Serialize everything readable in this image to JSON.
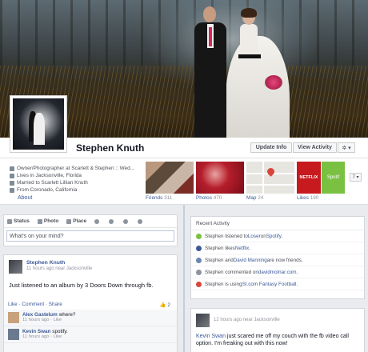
{
  "profile": {
    "name": "Stephen Knuth",
    "update_info": "Update Info",
    "view_activity": "View Activity",
    "gear": "✲ ▾"
  },
  "about": {
    "work": "Owner/Photographer at Scarlett & Stephen :: Wed...",
    "lives": "Lives in Jacksonville, Florida",
    "married": "Married to Scarlett Lillian Knuth",
    "from": "From Coronado, California",
    "link": "About"
  },
  "thumbs": {
    "friends_label": "Friends",
    "friends_count": "311",
    "photos_label": "Photos",
    "photos_count": "470",
    "map_label": "Map",
    "map_count": "24",
    "likes_label": "Likes",
    "likes_count": "190",
    "netflix": "NETFLIX",
    "spotify": "Spotif",
    "more": "7 ▾"
  },
  "composer": {
    "status": "Status",
    "photo": "Photo",
    "place": "Place",
    "placeholder": "What's on your mind?"
  },
  "activity": {
    "title": "Recent Activity",
    "items": [
      {
        "pre": "Stephen listened to ",
        "link": "Loser",
        "mid": " on ",
        "link2": "Spotify",
        "post": ".",
        "color": "#7ac142"
      },
      {
        "pre": "Stephen likes ",
        "link": "Netflix",
        "mid": "",
        "link2": "",
        "post": ".",
        "color": "#3b5998"
      },
      {
        "pre": "Stephen and ",
        "link": "David Manning",
        "mid": " are now friends.",
        "link2": "",
        "post": "",
        "color": "#6d84b4"
      },
      {
        "pre": "Stephen commented on ",
        "link": "davidmolnar.com",
        "mid": "",
        "link2": "",
        "post": ".",
        "color": "#8d949e"
      },
      {
        "pre": "Stephen is using ",
        "link": "SI.com Fantasy Football",
        "mid": "",
        "link2": "",
        "post": ".",
        "color": "#d8453a"
      }
    ]
  },
  "post1": {
    "author": "Stephen Knuth",
    "meta": "11 hours ago near Jacksonville",
    "text": "Just listened to an album by 3 Doors Down through fb.",
    "actions": "Like · Comment · Share",
    "likes": "👍 2",
    "comments": [
      {
        "name": "Alex Gastelum",
        "text": "where?",
        "meta": "11 hours ago · Like"
      },
      {
        "name": "Kevin Swan",
        "text": "spotify.",
        "meta": "11 hours ago · Like"
      }
    ]
  },
  "post2": {
    "meta": "12 hours ago near Jacksonville",
    "author": "Kevin Swan",
    "text": " just scared me off my couch with the fb video call option. I'm freaking out with this now!"
  }
}
